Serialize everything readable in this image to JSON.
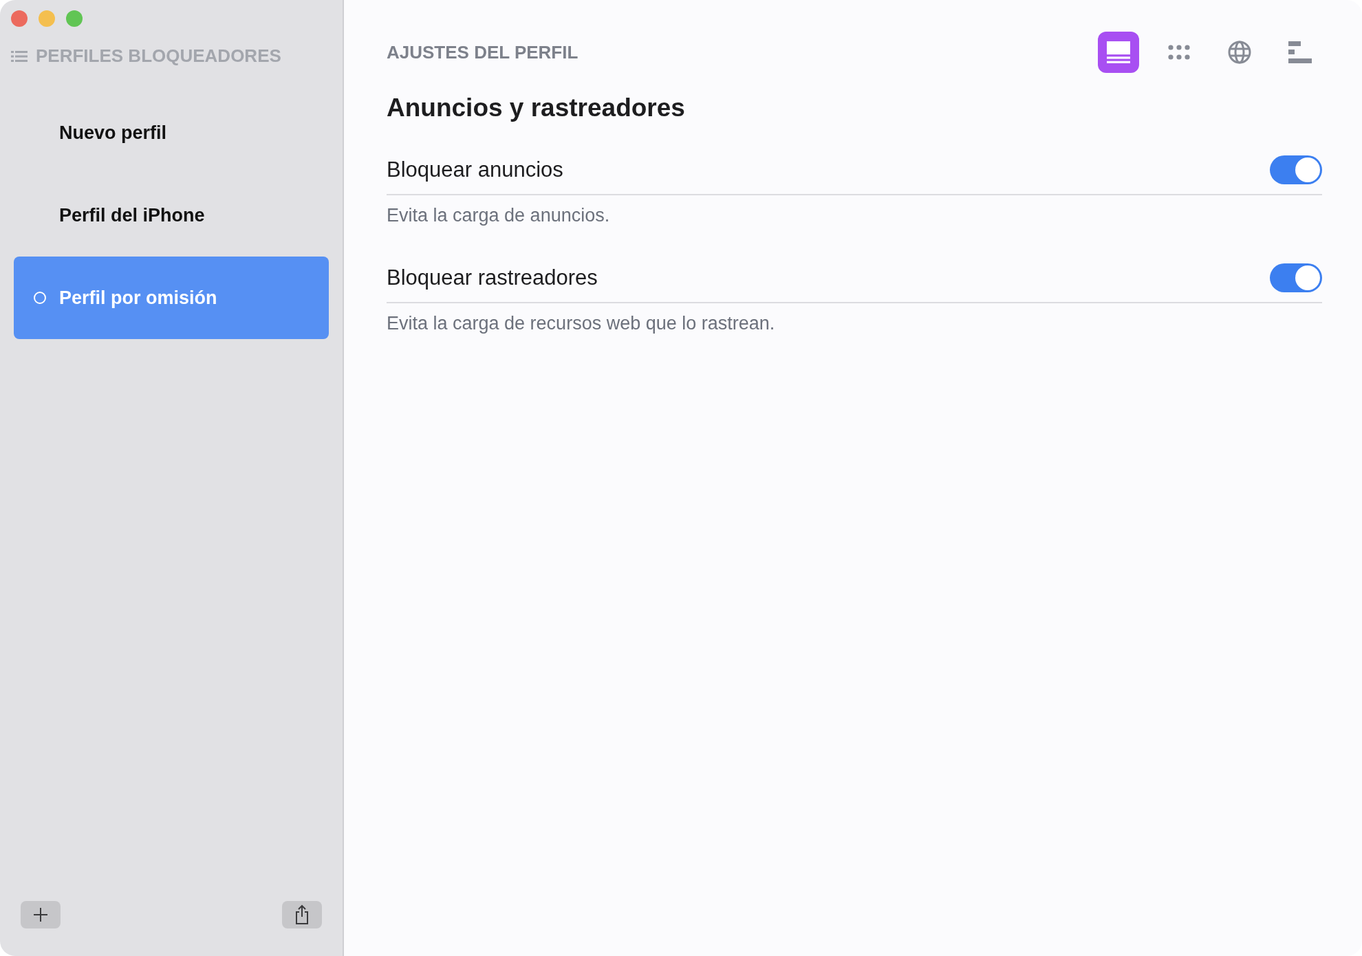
{
  "sidebar": {
    "title": "PERFILES BLOQUEADORES",
    "items": [
      {
        "label": "Nuevo perfil",
        "selected": false
      },
      {
        "label": "Perfil del iPhone",
        "selected": false
      },
      {
        "label": "Perfil por omisión",
        "selected": true
      }
    ]
  },
  "main": {
    "header": "AJUSTES DEL PERFIL",
    "toolbar": [
      {
        "kind": "card",
        "selected": true
      },
      {
        "kind": "dots",
        "selected": false
      },
      {
        "kind": "globe",
        "selected": false
      },
      {
        "kind": "bars",
        "selected": false
      }
    ],
    "title": "Anuncios y rastreadores",
    "settings": [
      {
        "label": "Bloquear anuncios",
        "on": true,
        "description": "Evita la carga de anuncios."
      },
      {
        "label": "Bloquear rastreadores",
        "on": true,
        "description": "Evita la carga de recursos web que lo rastrean."
      }
    ]
  }
}
